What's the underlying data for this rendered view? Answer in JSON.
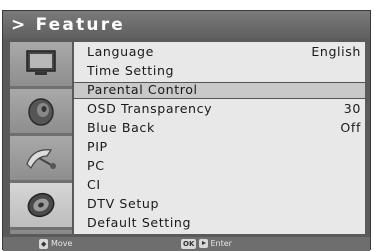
{
  "title": "> Feature",
  "menu": {
    "items": [
      {
        "label": "Language",
        "value": "English"
      },
      {
        "label": "Time Setting",
        "value": ""
      },
      {
        "label": "Parental Control",
        "value": ""
      },
      {
        "label": "OSD Transparency",
        "value": "30"
      },
      {
        "label": "Blue Back",
        "value": "Off"
      },
      {
        "label": "PIP",
        "value": ""
      },
      {
        "label": "PC",
        "value": ""
      },
      {
        "label": "CI",
        "value": ""
      },
      {
        "label": "DTV Setup",
        "value": ""
      },
      {
        "label": "Default Setting",
        "value": ""
      }
    ],
    "selected_index": 2
  },
  "icons": [
    "tv-screen-icon",
    "speaker-icon",
    "satellite-dish-icon",
    "feature-disc-icon"
  ],
  "footer": {
    "move_label": "Move",
    "ok_key": "OK",
    "enter_label": "Enter"
  }
}
